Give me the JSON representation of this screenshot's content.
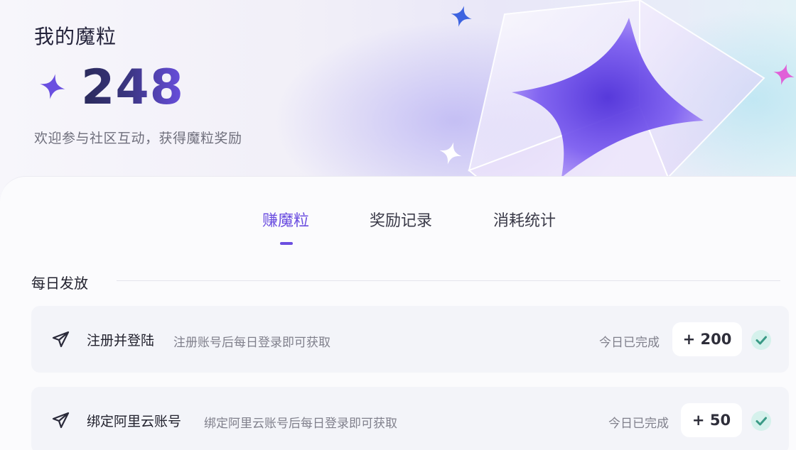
{
  "header": {
    "title": "我的魔粒",
    "points": "248",
    "subtitle": "欢迎参与社区互动，获得魔粒奖励"
  },
  "tabs": [
    {
      "label": "赚魔粒",
      "active": true
    },
    {
      "label": "奖励记录",
      "active": false
    },
    {
      "label": "消耗统计",
      "active": false
    }
  ],
  "section": {
    "title": "每日发放"
  },
  "tasks": [
    {
      "name": "注册并登陆",
      "desc": "注册账号后每日登录即可获取",
      "status": "今日已完成",
      "reward": "+ 200",
      "icon": "paper-plane-icon",
      "completed": true
    },
    {
      "name": "绑定阿里云账号",
      "desc": "绑定阿里云账号后每日登录即可获取",
      "status": "今日已完成",
      "reward": "+ 50",
      "icon": "paper-plane-icon",
      "completed": true
    }
  ],
  "colors": {
    "accent": "#6b4ee0",
    "check": "#3a9a86",
    "sparkle_purple": "#6a4fe0",
    "sparkle_blue": "#3d63e0",
    "sparkle_pink": "#e060d8"
  }
}
